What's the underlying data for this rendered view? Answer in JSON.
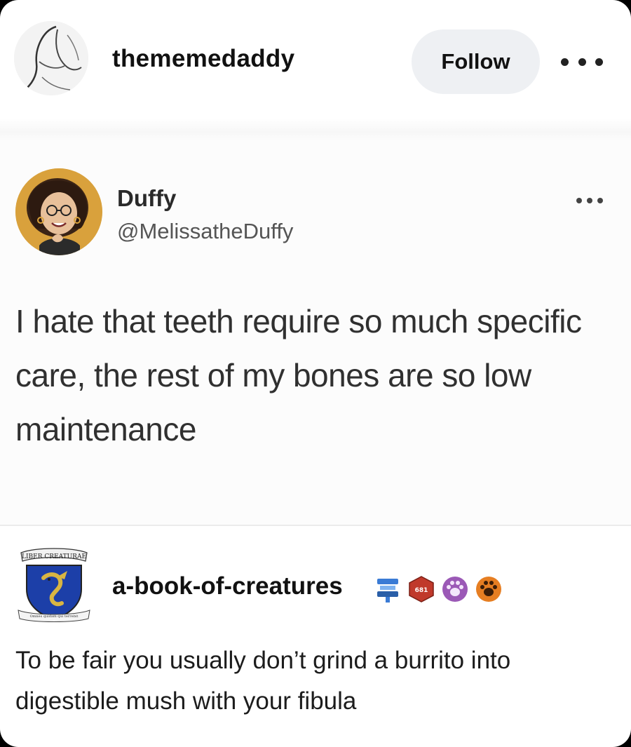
{
  "header": {
    "username": "thememedaddy",
    "follow_label": "Follow",
    "more_icon": "more-horizontal-icon"
  },
  "quoted_post": {
    "display_name": "Duffy",
    "handle": "@MelissatheDuffy",
    "text": "I hate that teeth require so much specific care, the rest of my bones are so low maintenance",
    "more_icon": "more-horizontal-icon"
  },
  "reblog": {
    "username": "a-book-of-creatures",
    "crest_banner": "LIBER CREATURAE",
    "crest_motto": "Omnes quidam qui terrebit",
    "badges": [
      {
        "icon": "fan-badge-icon",
        "color": "#3a7bd5"
      },
      {
        "icon": "d20-badge-icon",
        "color": "#c0392b",
        "label": "681"
      },
      {
        "icon": "paw-badge-icon",
        "color": "#9b59b6"
      },
      {
        "icon": "paw-badge-icon",
        "color": "#e67e22"
      }
    ],
    "text": "To be fair you usually don’t grind a burrito into digestible mush with your fibula"
  },
  "colors": {
    "follow_bg": "#eef0f3",
    "card_bg": "#ffffff",
    "frame_bg": "#000000"
  }
}
